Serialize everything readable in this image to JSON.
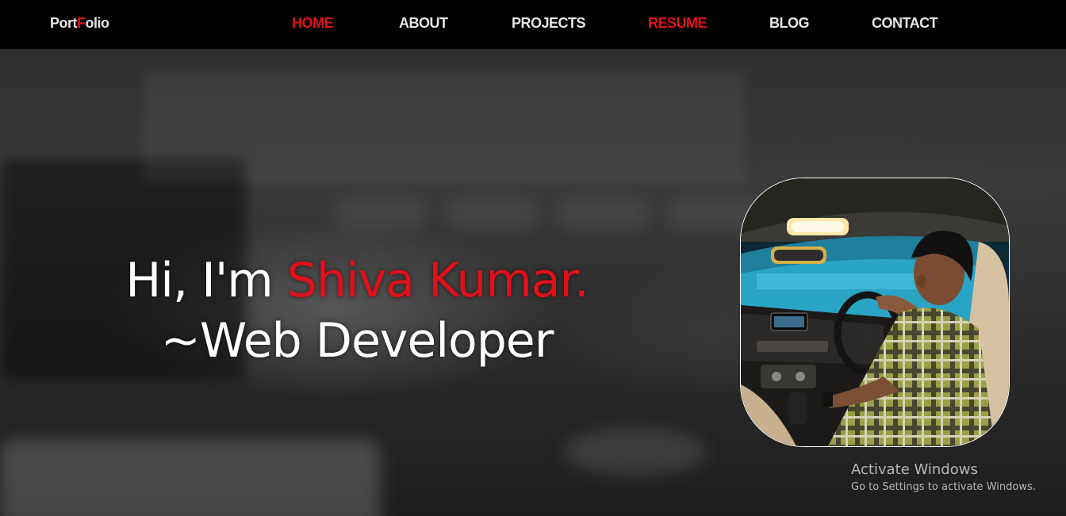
{
  "navbar": {
    "brand_prefix": "Port",
    "brand_accent": "F",
    "brand_suffix": "olio",
    "items": [
      {
        "label": "HOME",
        "active": true
      },
      {
        "label": "ABOUT",
        "active": false
      },
      {
        "label": "PROJECTS",
        "active": false
      },
      {
        "label": "RESUME",
        "active": true
      },
      {
        "label": "BLOG",
        "active": false
      },
      {
        "label": "CONTACT",
        "active": false
      }
    ]
  },
  "hero": {
    "greeting": "Hi, I'm ",
    "name": "Shiva Kumar.",
    "role": "~Web Developer"
  },
  "watermark": {
    "title": "Activate Windows",
    "subtitle": "Go to Settings to activate Windows."
  },
  "colors": {
    "accent": "#e0101a",
    "nav_bg": "#000000",
    "text": "#ffffff"
  }
}
